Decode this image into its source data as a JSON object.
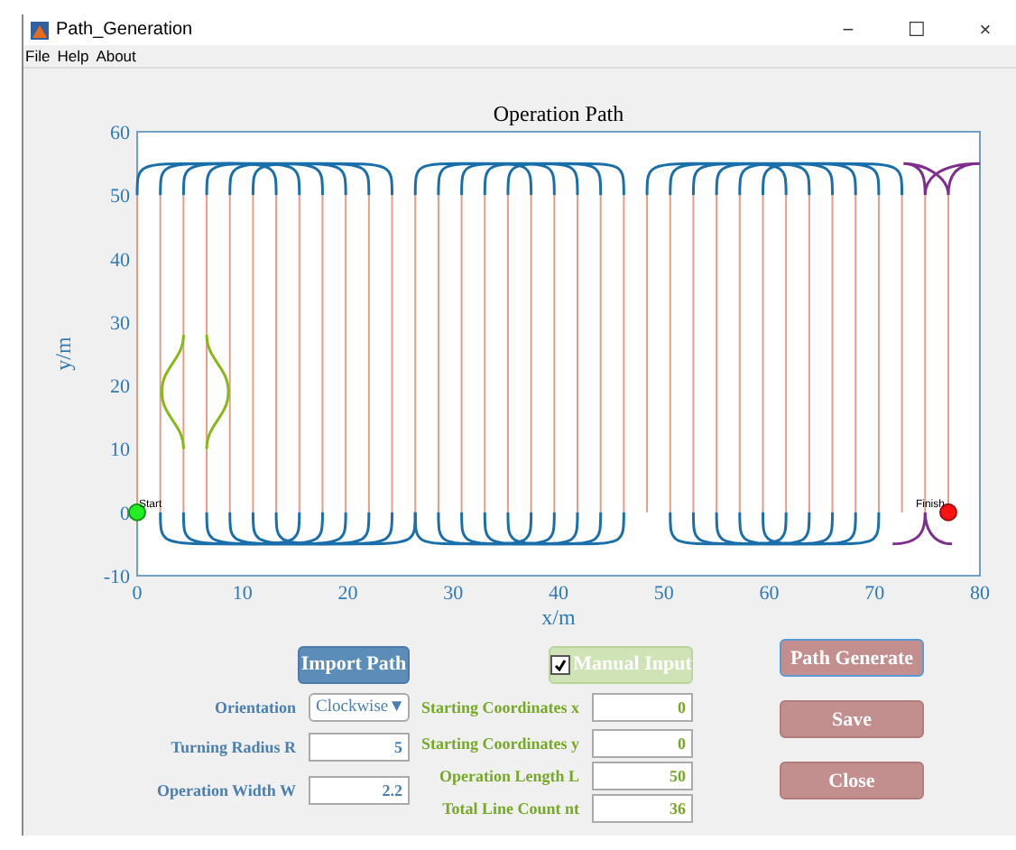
{
  "window": {
    "title": "Path_Generation",
    "controls": [
      "−",
      "☐",
      "×"
    ]
  },
  "menu": [
    "File",
    "Help",
    "About"
  ],
  "plot": {
    "title": "Operation Path",
    "xlabel": "x/m",
    "ylabel": "y/m",
    "xtick_labels": [
      "0",
      "10",
      "20",
      "30",
      "40",
      "50",
      "60",
      "70",
      "80"
    ],
    "ytick_labels": [
      "60",
      "50",
      "40",
      "30",
      "20",
      "10",
      "0",
      "-10"
    ],
    "start_label": "Start",
    "finish_label": "Finish"
  },
  "buttons": {
    "import": "Import Path",
    "manual": {
      "label": "Manual Input",
      "checked": true
    },
    "generate": "Path Generate",
    "save": "Save",
    "close": "Close"
  },
  "left_fields": [
    {
      "kind": "dropdown",
      "label": "Orientation",
      "value": "Clockwise",
      "caret": "▼"
    },
    {
      "kind": "input",
      "label": "Turning Radius R",
      "value": "5"
    },
    {
      "kind": "input",
      "label": "Operation Width W",
      "value": "2.2"
    }
  ],
  "middle_fields": [
    {
      "label": "Starting Coordinates x",
      "value": "0"
    },
    {
      "label": "Starting Coordinates y",
      "value": "0"
    },
    {
      "label": "Operation Length L",
      "value": "50"
    },
    {
      "label": "Total Line Count nt",
      "value": "36"
    }
  ]
}
